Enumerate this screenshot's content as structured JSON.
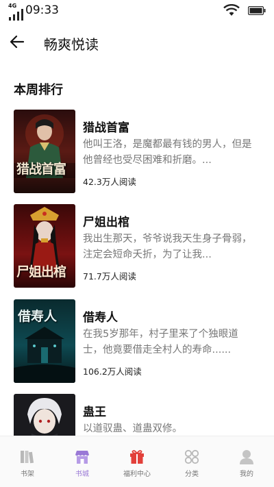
{
  "status": {
    "network": "4G",
    "time": "09:33"
  },
  "header": {
    "title": "畅爽悦读"
  },
  "section": {
    "title": "本周排行"
  },
  "books": [
    {
      "title": "猎战首富",
      "description": "他叫王洛，是魔都最有钱的男人，但是他曾经也受尽困难和折磨。...",
      "reads": "42.3万人阅读",
      "cover_text": "猎战首富"
    },
    {
      "title": "尸姐出棺",
      "description": "我出生那天，爷爷说我天生身子骨弱，注定会短命夭折，为了让我...",
      "reads": "71.7万人阅读",
      "cover_text": "尸姐出棺"
    },
    {
      "title": "借寿人",
      "description": "在我5岁那年，村子里来了个独眼道士，他竟要借走全村人的寿命......",
      "reads": "106.2万人阅读",
      "cover_text": "借寿人"
    },
    {
      "title": "蛊王",
      "description": "以道驭蛊、道蛊双修。",
      "reads": "",
      "cover_text": ""
    }
  ],
  "tabs": [
    {
      "label": "书架",
      "icon": "bookshelf-icon"
    },
    {
      "label": "书城",
      "icon": "bookstore-icon"
    },
    {
      "label": "福利中心",
      "icon": "gift-icon"
    },
    {
      "label": "分类",
      "icon": "category-icon"
    },
    {
      "label": "我的",
      "icon": "profile-icon"
    }
  ],
  "colors": {
    "accent": "#9a79d6",
    "gift": "#e2403a",
    "muted_icon": "#b8b8b8"
  }
}
